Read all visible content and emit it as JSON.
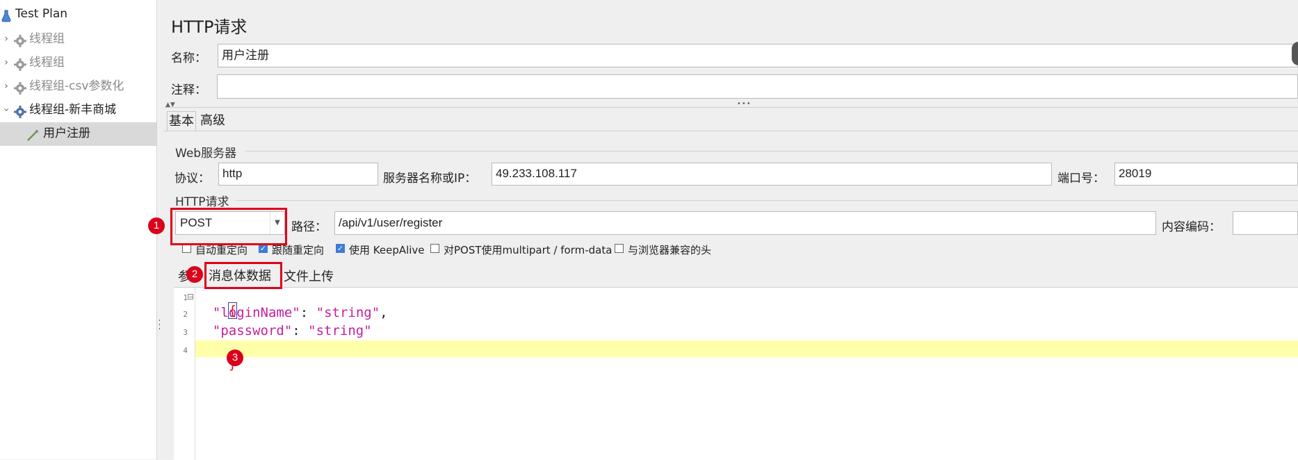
{
  "tree": {
    "items": [
      {
        "label": "Test Plan",
        "expanded": true
      },
      {
        "label": "线程组",
        "disabled": true
      },
      {
        "label": "线程组",
        "disabled": true
      },
      {
        "label": "线程组-csv参数化",
        "disabled": true
      },
      {
        "label": "线程组-新丰商城",
        "expanded": true
      },
      {
        "label": "用户注册",
        "selected": true
      }
    ]
  },
  "panel": {
    "title": "HTTP请求",
    "name_label": "名称：",
    "name_value": "用户注册",
    "comment_label": "注释：",
    "comment_value": ""
  },
  "tabs": {
    "basic": "基本",
    "advanced": "高级"
  },
  "web_server": {
    "group_title": "Web服务器",
    "protocol_label": "协议：",
    "protocol_value": "http",
    "server_label": "服务器名称或IP：",
    "server_value": "49.233.108.117",
    "port_label": "端口号：",
    "port_value": "28019"
  },
  "http_request": {
    "group_title": "HTTP请求",
    "method": "POST",
    "path_label": "路径：",
    "path_value": "/api/v1/user/register",
    "encoding_label": "内容编码：",
    "encoding_value": ""
  },
  "options": {
    "auto_redirect": {
      "label": "自动重定向",
      "checked": false
    },
    "follow_redirect": {
      "label": "跟随重定向",
      "checked": true
    },
    "keepalive": {
      "label": "使用 KeepAlive",
      "checked": true
    },
    "multipart": {
      "label": "对POST使用multipart / form-data",
      "checked": false
    },
    "browser_headers": {
      "label": "与浏览器兼容的头",
      "checked": false
    }
  },
  "body_tabs": {
    "params": "参",
    "body_data": "消息体数据",
    "file_upload": "文件上传"
  },
  "editor": {
    "line_numbers": [
      "1",
      "2",
      "3",
      "4"
    ],
    "lines": {
      "open": "{",
      "k1": "\"loginName\"",
      "v1": "\"string\"",
      "k2": "\"password\"",
      "v2": "\"string\"",
      "close": "}"
    }
  },
  "annotations": [
    "1",
    "2",
    "3"
  ],
  "colors": {
    "annotation_red": "#e0001a",
    "json_key": "#c21f9f",
    "current_line": "#ffffaa",
    "checkbox_checked": "#3d7bd6"
  }
}
